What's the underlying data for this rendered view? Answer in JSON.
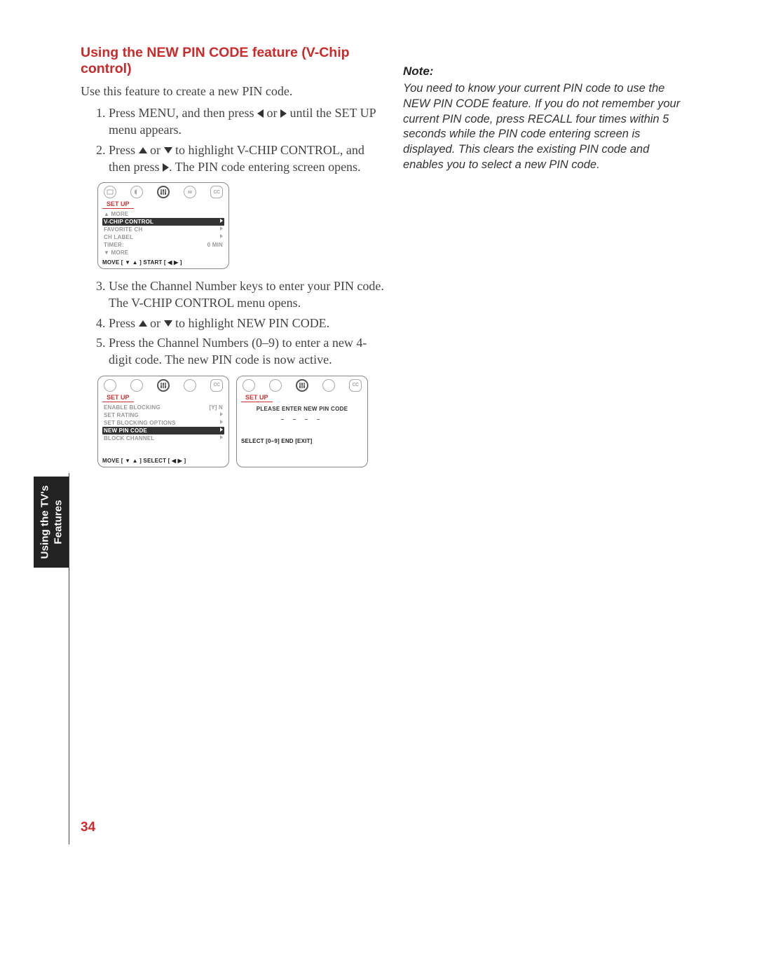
{
  "heading": "Using the NEW PIN CODE feature (V-Chip control)",
  "intro": "Use this feature to create a new PIN code.",
  "steps": {
    "s1a": "Press MENU, and then press ",
    "s1b": " or ",
    "s1c": " until the SET UP menu appears.",
    "s2a": "Press ",
    "s2b": " or ",
    "s2c": " to highlight V-CHIP CONTROL, and then press ",
    "s2d": ". The PIN code entering screen opens.",
    "s3": "Use the Channel Number keys to enter your PIN code. The V-CHIP CONTROL menu opens.",
    "s4a": "Press ",
    "s4b": " or ",
    "s4c": " to highlight NEW PIN CODE.",
    "s5": "Press the Channel Numbers (0–9) to enter a new 4-digit code. The new PIN code is now active."
  },
  "note": {
    "title": "Note:",
    "body": "You need to know your current PIN code to use the NEW PIN CODE feature. If you do not remember your current PIN code, press RECALL four times within 5 seconds while the PIN code entering screen is displayed. This clears the existing PIN code and enables you to select a new PIN code."
  },
  "osd": {
    "setup_label": "SET UP",
    "cc": "CC",
    "menu1": {
      "more_top": "▲ MORE",
      "vchip": "V-CHIP CONTROL",
      "fav": "FAVORITE CH",
      "chlabel": "CH LABEL",
      "timer": "TIMER:",
      "timer_val": "0 MIN",
      "more_bot": "▼ MORE",
      "hints": "MOVE [ ▼ ▲ ]    START [ ◀ ▶ ]"
    },
    "menu2": {
      "enable": "ENABLE BLOCKING",
      "enable_val": "[Y] N",
      "setrating": "SET RATING",
      "setblock": "SET BLOCKING OPTIONS",
      "newpin": "NEW PIN CODE",
      "blockch": "BLOCK CHANNEL",
      "hints": "MOVE [ ▼ ▲ ]    SELECT [ ◀ ▶ ]"
    },
    "menu3": {
      "prompt": "PLEASE ENTER NEW PIN CODE",
      "dashes": "– – – –",
      "hints": "SELECT [0–9]   END [EXIT]"
    }
  },
  "sidetab": {
    "line1": "Using the TV's",
    "line2": "Features"
  },
  "page_number": "34"
}
